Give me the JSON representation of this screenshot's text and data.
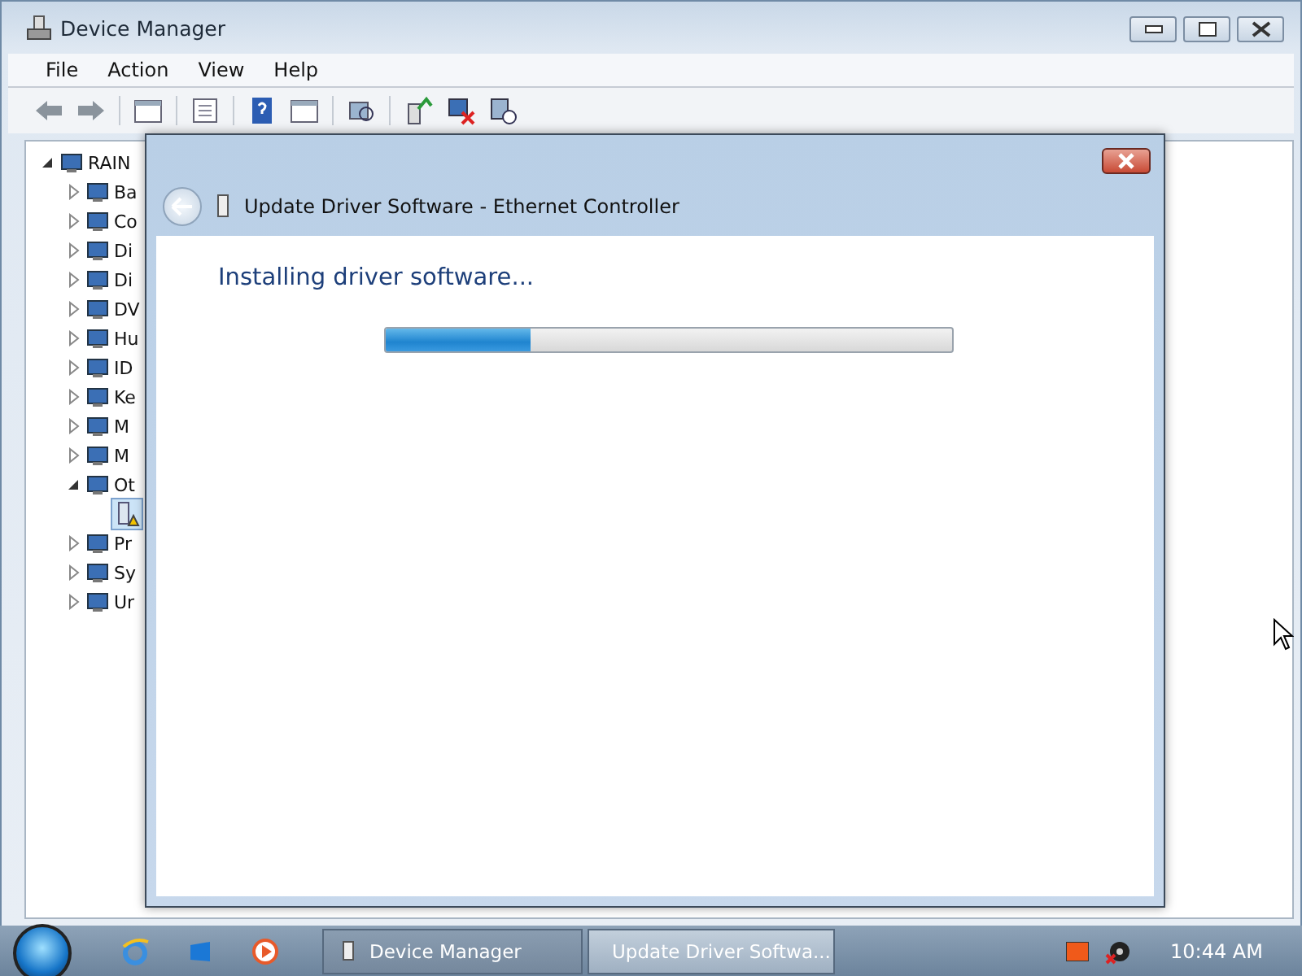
{
  "window": {
    "title": "Device Manager"
  },
  "menu": [
    "File",
    "Action",
    "View",
    "Help"
  ],
  "tree": {
    "label": "RAIN",
    "expanded": true,
    "children": [
      {
        "label": "Ba",
        "expanded": false
      },
      {
        "label": "Co",
        "expanded": false
      },
      {
        "label": "Di",
        "expanded": false
      },
      {
        "label": "Di",
        "expanded": false
      },
      {
        "label": "DV",
        "expanded": false
      },
      {
        "label": "Hu",
        "expanded": false
      },
      {
        "label": "ID",
        "expanded": false
      },
      {
        "label": "Ke",
        "expanded": false
      },
      {
        "label": "M",
        "expanded": false
      },
      {
        "label": "M",
        "expanded": false
      },
      {
        "label": "Ot",
        "expanded": true,
        "children": [
          {
            "selected": true
          }
        ]
      },
      {
        "label": "Pr",
        "expanded": false
      },
      {
        "label": "Sy",
        "expanded": false
      },
      {
        "label": "Ur",
        "expanded": false
      }
    ]
  },
  "dialog": {
    "title": "Update Driver Software - Ethernet Controller",
    "heading": "Installing driver software...",
    "progress": {
      "level": 0.255
    }
  },
  "taskbar": {
    "tasks": [
      {
        "label": "Device Manager",
        "selected": false
      },
      {
        "label": "Update Driver Softwa...",
        "selected": true
      }
    ],
    "clock": "10:44 AM"
  }
}
